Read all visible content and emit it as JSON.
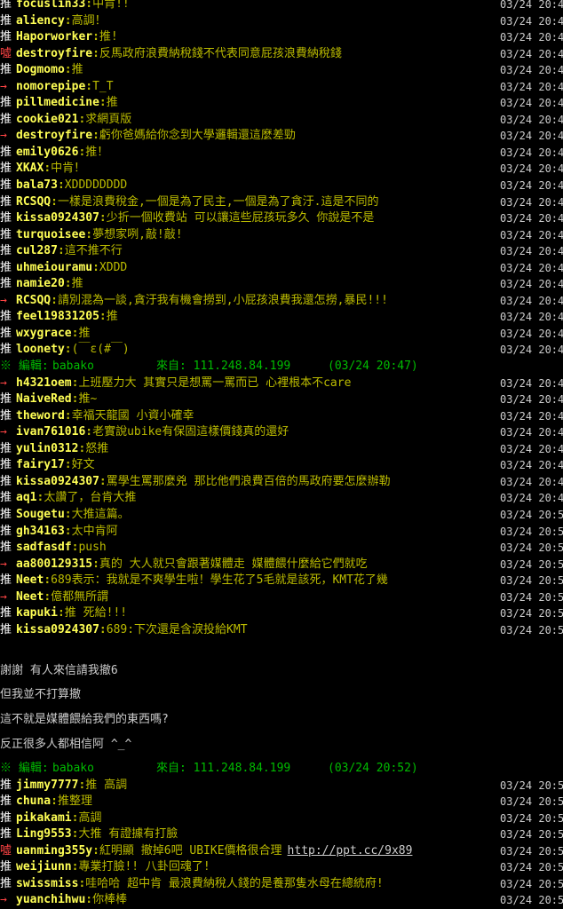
{
  "pushes_a": [
    {
      "tag": "推",
      "type": "push",
      "user": "focuslin33",
      "text": "中肯!!",
      "time": "03/24 20:4"
    },
    {
      "tag": "推",
      "type": "push",
      "user": "aliency",
      "text": "高調！",
      "time": "03/24 20:4"
    },
    {
      "tag": "推",
      "type": "push",
      "user": "Haporworker",
      "text": "推!",
      "time": "03/24 20:4"
    },
    {
      "tag": "噓",
      "type": "boo",
      "user": "destroyfire",
      "text": "反馬政府浪費納稅錢不代表同意屁孩浪費納稅錢",
      "time": "03/24 20:4"
    },
    {
      "tag": "推",
      "type": "push",
      "user": "Dogmomo",
      "text": "推",
      "time": "03/24 20:4"
    },
    {
      "tag": "→",
      "type": "arrow",
      "user": "nomorepipe",
      "text": "T_T",
      "time": "03/24 20:4"
    },
    {
      "tag": "推",
      "type": "push",
      "user": "pillmedicine",
      "text": "推",
      "time": "03/24 20:4"
    },
    {
      "tag": "推",
      "type": "push",
      "user": "cookie021",
      "text": "求網頁版",
      "time": "03/24 20:4"
    },
    {
      "tag": "→",
      "type": "arrow",
      "user": "destroyfire",
      "text": "虧你爸媽給你念到大學邏輯還這麼差勁",
      "time": "03/24 20:4"
    },
    {
      "tag": "推",
      "type": "push",
      "user": "emily0626",
      "text": "推！",
      "time": "03/24 20:4"
    },
    {
      "tag": "推",
      "type": "push",
      "user": "XKAX",
      "text": "中肯！",
      "time": "03/24 20:4"
    },
    {
      "tag": "推",
      "type": "push",
      "user": "bala73",
      "text": "XDDDDDDDD",
      "time": "03/24 20:4"
    },
    {
      "tag": "推",
      "type": "push",
      "user": "RCSQQ",
      "text": "一樣是浪費稅金,一個是為了民主,一個是為了貪汙.這是不同的",
      "time": "03/24 20:4"
    },
    {
      "tag": "推",
      "type": "push",
      "user": "kissa0924307",
      "text": "少折一個收費站 可以讓這些屁孩玩多久 你說是不是",
      "time": "03/24 20:4"
    },
    {
      "tag": "推",
      "type": "push",
      "user": "turquoisee",
      "text": "夢想家咧,敲!敲!",
      "time": "03/24 20:4"
    },
    {
      "tag": "推",
      "type": "push",
      "user": "cul287",
      "text": "這不推不行",
      "time": "03/24 20:4"
    },
    {
      "tag": "推",
      "type": "push",
      "user": "uhmeiouramu",
      "text": "XDDD",
      "time": "03/24 20:4"
    },
    {
      "tag": "推",
      "type": "push",
      "user": "namie20",
      "text": "推",
      "time": "03/24 20:4"
    },
    {
      "tag": "→",
      "type": "arrow",
      "user": "RCSQQ",
      "text": "請別混為一談,貪汙我有機會撈到,小屁孩浪費我還怎撈,暴民!!!",
      "time": "03/24 20:4"
    },
    {
      "tag": "推",
      "type": "push",
      "user": "feel19831205",
      "text": "推",
      "time": "03/24 20:4"
    },
    {
      "tag": "推",
      "type": "push",
      "user": "wxygrace",
      "text": "推",
      "time": "03/24 20:4"
    },
    {
      "tag": "推",
      "type": "push",
      "user": "loonety",
      "text": "(￣ε(#￣)",
      "time": "03/24 20:4"
    }
  ],
  "edit_1": {
    "label": "※ 編輯:",
    "user": "babako",
    "from": "來自: 111.248.84.199",
    "time": "(03/24 20:47)"
  },
  "pushes_b": [
    {
      "tag": "→",
      "type": "arrow",
      "user": "h4321oem",
      "text": "上班壓力大 其實只是想罵一罵而已 心裡根本不care",
      "time": "03/24 20:4"
    },
    {
      "tag": "推",
      "type": "push",
      "user": "NaiveRed",
      "text": "推~",
      "time": "03/24 20:4"
    },
    {
      "tag": "推",
      "type": "push",
      "user": "theword",
      "text": "幸福天龍國  小資小確幸",
      "time": "03/24 20:4"
    },
    {
      "tag": "→",
      "type": "arrow",
      "user": "ivan761016",
      "text": "老實說ubike有保固這樣價錢真的還好",
      "time": "03/24 20:4"
    },
    {
      "tag": "推",
      "type": "push",
      "user": "yulin0312",
      "text": "怒推",
      "time": "03/24 20:4"
    },
    {
      "tag": "推",
      "type": "push",
      "user": "fairy17",
      "text": "好文",
      "time": "03/24 20:4"
    },
    {
      "tag": "推",
      "type": "push",
      "user": "kissa0924307",
      "text": "罵學生罵那麼兇 那比他們浪費百倍的馬政府要怎麼辦勒",
      "time": "03/24 20:4"
    },
    {
      "tag": "推",
      "type": "push",
      "user": "aq1",
      "text": "太讚了，台肯大推",
      "time": "03/24 20:4"
    },
    {
      "tag": "推",
      "type": "push",
      "user": "Sougetu",
      "text": "大推這篇。",
      "time": "03/24 20:5"
    },
    {
      "tag": "推",
      "type": "push",
      "user": "gh34163",
      "text": "太中肯阿",
      "time": "03/24 20:5"
    },
    {
      "tag": "推",
      "type": "push",
      "user": "sadfasdf",
      "text": "push",
      "time": "03/24 20:5"
    },
    {
      "tag": "→",
      "type": "arrow",
      "user": "aa800129315",
      "text": "真的 大人就只會跟著媒體走 媒體餵什麼給它們就吃",
      "time": "03/24 20:5"
    },
    {
      "tag": "推",
      "type": "push",
      "user": "Neet",
      "text": "689表示：我就是不爽學生啦！學生花了5毛就是該死，KMT花了幾",
      "time": "03/24 20:5"
    },
    {
      "tag": "→",
      "type": "arrow",
      "user": "Neet",
      "text": "億都無所謂",
      "time": "03/24 20:5"
    },
    {
      "tag": "推",
      "type": "push",
      "user": "kapuki",
      "text": "推  死給!!!",
      "time": "03/24 20:5"
    },
    {
      "tag": "推",
      "type": "push",
      "user": "kissa0924307",
      "text": "689:下次還是含淚投給KMT",
      "time": "03/24 20:5"
    }
  ],
  "body_lines": [
    "謝謝 有人來信請我撤6",
    "但我並不打算撤",
    "這不就是媒體餵給我們的東西嗎?",
    "反正很多人都相信阿 ^_^"
  ],
  "edit_2": {
    "label": "※ 編輯:",
    "user": "babako",
    "from": "來自: 111.248.84.199",
    "time": "(03/24 20:52)"
  },
  "pushes_c": [
    {
      "tag": "推",
      "type": "push",
      "user": "jimmy7777",
      "text": "推  高調",
      "time": "03/24 20:5"
    },
    {
      "tag": "推",
      "type": "push",
      "user": "chuna",
      "text": "推整理",
      "time": "03/24 20:5"
    },
    {
      "tag": "推",
      "type": "push",
      "user": "pikakami",
      "text": "高調",
      "time": "03/24 20:5"
    },
    {
      "tag": "推",
      "type": "push",
      "user": "Ling9553",
      "text": "大推 有證據有打臉",
      "time": "03/24 20:5"
    },
    {
      "tag": "噓",
      "type": "boo",
      "user": "uanming355y",
      "text": "紅明顯 撤掉6吧 UBIKE價格很合理",
      "time": "03/24 20:5",
      "url": "http://ppt.cc/9x89"
    },
    {
      "tag": "推",
      "type": "push",
      "user": "weijiunn",
      "text": "專業打臉!! 八卦回魂了!",
      "time": "03/24 20:5"
    },
    {
      "tag": "推",
      "type": "push",
      "user": "swissmiss",
      "text": "哇哈哈 超中肯 最浪費納稅人錢的是養那隻水母在總統府!",
      "time": "03/24 20:5"
    },
    {
      "tag": "→",
      "type": "arrow",
      "user": "yuanchihwu",
      "text": "你棒棒",
      "time": "03/24 20:5"
    }
  ]
}
